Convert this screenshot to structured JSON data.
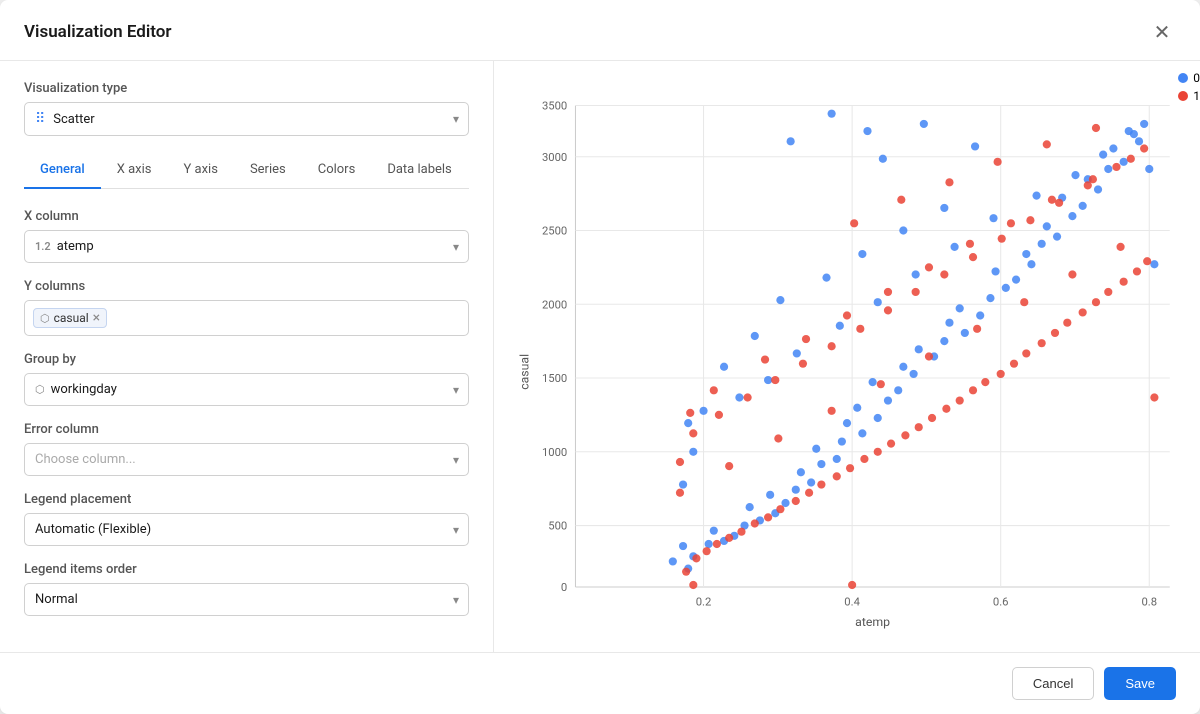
{
  "modal": {
    "title": "Visualization Editor",
    "close_label": "×"
  },
  "visualization_type": {
    "label": "Visualization type",
    "selected": "Scatter",
    "icon": "scatter-icon"
  },
  "tabs": [
    {
      "label": "General",
      "active": true
    },
    {
      "label": "X axis",
      "active": false
    },
    {
      "label": "Y axis",
      "active": false
    },
    {
      "label": "Series",
      "active": false
    },
    {
      "label": "Colors",
      "active": false
    },
    {
      "label": "Data labels",
      "active": false
    }
  ],
  "x_column": {
    "label": "X column",
    "selected": "atemp",
    "type_icon": "1.2"
  },
  "y_columns": {
    "label": "Y columns",
    "tags": [
      {
        "value": "casual",
        "type_icon": "⬡"
      }
    ]
  },
  "group_by": {
    "label": "Group by",
    "selected": "workingday",
    "type_icon": "⬡"
  },
  "error_column": {
    "label": "Error column",
    "placeholder": "Choose column..."
  },
  "legend_placement": {
    "label": "Legend placement",
    "selected": "Automatic (Flexible)"
  },
  "legend_items_order": {
    "label": "Legend items order",
    "selected": "Normal"
  },
  "chart": {
    "x_axis_label": "atemp",
    "y_axis_label": "casual",
    "x_ticks": [
      "0.2",
      "0.4",
      "0.6",
      "0.8"
    ],
    "y_ticks": [
      "0",
      "500",
      "1000",
      "1500",
      "2000",
      "2500",
      "3000",
      "3500"
    ],
    "legend": [
      {
        "label": "0",
        "color": "#4285f4"
      },
      {
        "label": "1",
        "color": "#ea4335"
      }
    ]
  },
  "footer": {
    "cancel_label": "Cancel",
    "save_label": "Save"
  }
}
